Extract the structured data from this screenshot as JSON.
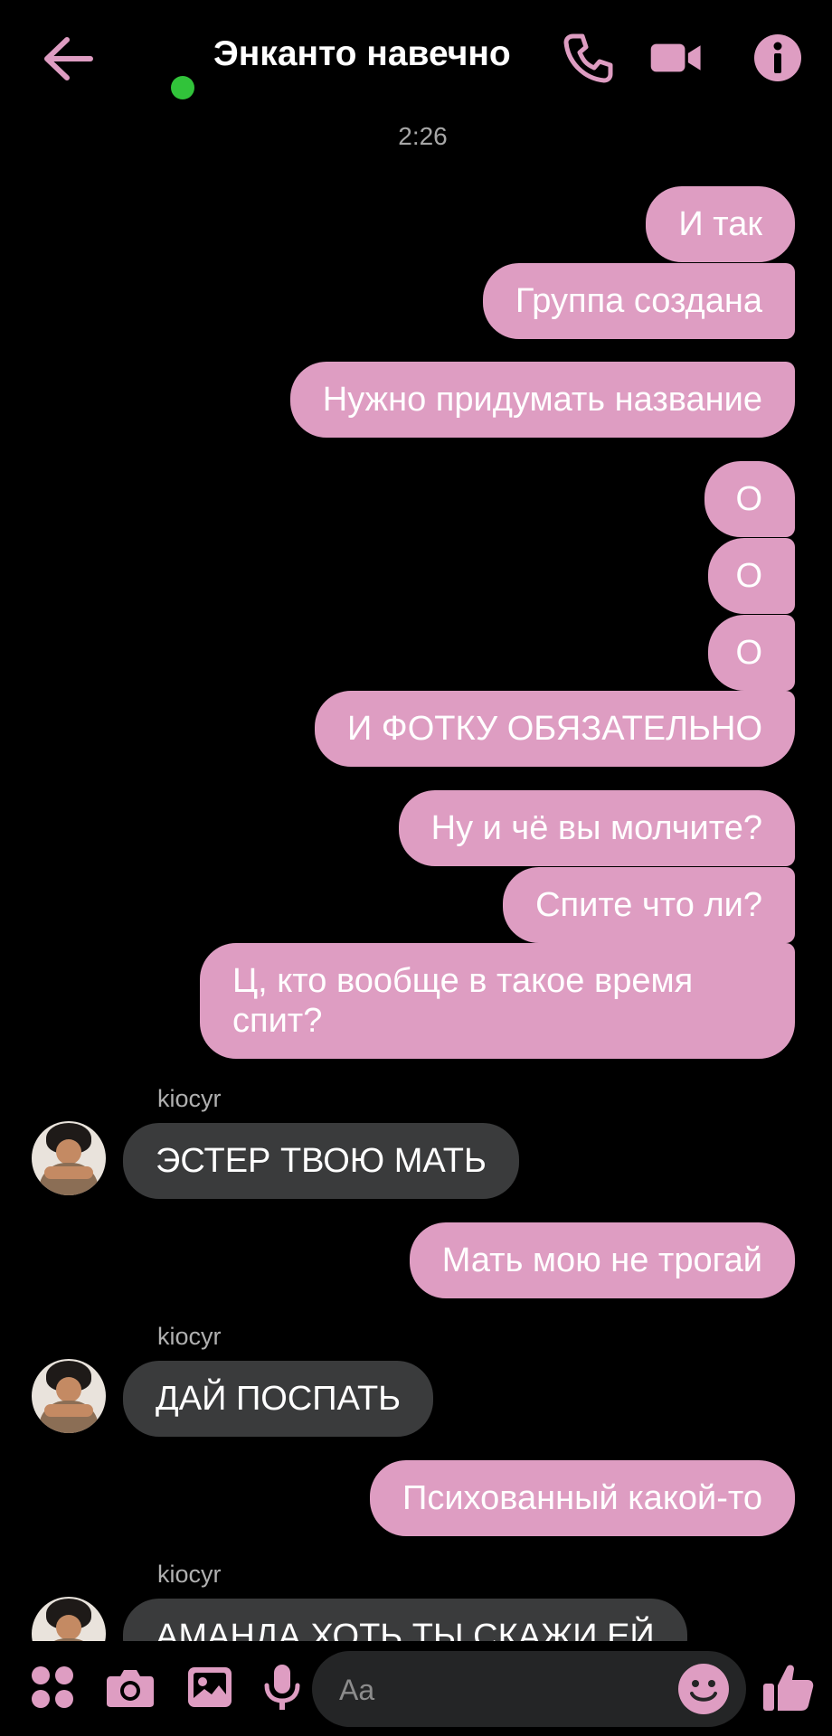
{
  "header": {
    "title": "Энканто навечно",
    "online": true
  },
  "colors": {
    "accent": "#de9dc2",
    "incoming": "#3a3b3c",
    "online": "#31c33a",
    "background": "#000000"
  },
  "timestamp": "2:26",
  "messages": [
    {
      "dir": "out",
      "text": "И так"
    },
    {
      "dir": "out",
      "text": "Группа создана"
    },
    {
      "dir": "out",
      "text": "Нужно придумать название"
    },
    {
      "dir": "out",
      "text": "О"
    },
    {
      "dir": "out",
      "text": "О"
    },
    {
      "dir": "out",
      "text": "О"
    },
    {
      "dir": "out",
      "text": "И ФОТКУ ОБЯЗАТЕЛЬНО"
    },
    {
      "dir": "out",
      "text": "Ну и чё вы молчите?"
    },
    {
      "dir": "out",
      "text": "Спите что ли?"
    },
    {
      "dir": "out",
      "text": "Ц, кто вообще в такое время спит?"
    },
    {
      "dir": "in",
      "sender": "kiocyr",
      "text": "ЭСТЕР ТВОЮ МАТЬ"
    },
    {
      "dir": "out",
      "text": "Мать мою не трогай"
    },
    {
      "dir": "in",
      "sender": "kiocyr",
      "text": "ДАЙ ПОСПАТЬ"
    },
    {
      "dir": "out",
      "text": "Психованный какой-то"
    },
    {
      "dir": "in",
      "sender": "kiocyr",
      "text": "АМАНДА ХОТЬ ТЫ СКАЖИ ЕЙ"
    }
  ],
  "composer": {
    "placeholder": "Aa"
  },
  "icons": {
    "back": "arrow-left-icon",
    "phone": "phone-icon",
    "video": "video-camera-icon",
    "info": "info-icon",
    "apps": "four-dots-icon",
    "camera": "camera-icon",
    "gallery": "image-icon",
    "mic": "microphone-icon",
    "emoji": "emoji-icon",
    "like": "thumbs-up-icon"
  }
}
